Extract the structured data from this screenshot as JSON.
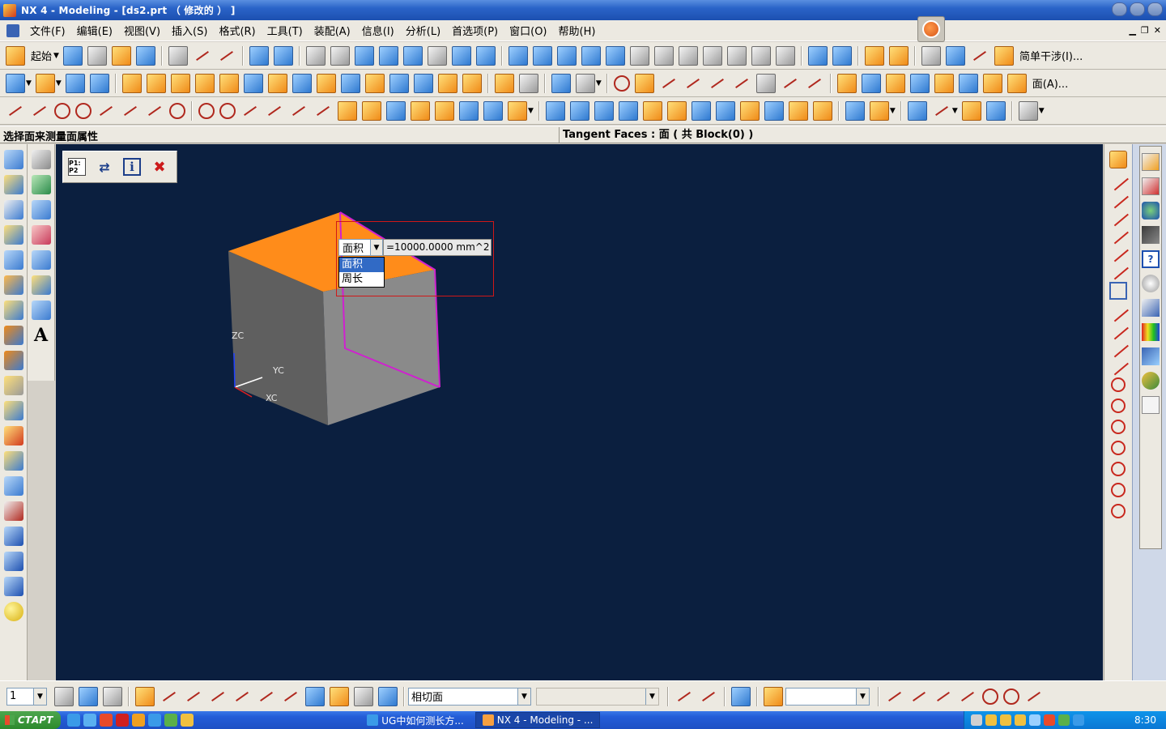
{
  "window": {
    "title": "NX 4 - Modeling - [ds2.prt （ 修改的 ） ]"
  },
  "menubar": {
    "items": [
      "文件(F)",
      "编辑(E)",
      "视图(V)",
      "插入(S)",
      "格式(R)",
      "工具(T)",
      "装配(A)",
      "信息(I)",
      "分析(L)",
      "首选项(P)",
      "窗口(O)",
      "帮助(H)"
    ]
  },
  "toolbar1": {
    "start_label": "起始",
    "right_label": "简单干涉(I)..."
  },
  "toolbar2": {
    "face_label": "面(A)..."
  },
  "status": {
    "prompt": "选择面来测量面属性",
    "selection": "Tangent Faces : 面 ( 共 Block(0) )"
  },
  "viewport": {
    "measure": {
      "selected": "面积",
      "value": "=10000.0000 mm^2",
      "options": [
        "面积",
        "周长"
      ]
    },
    "wcs": {
      "zc": "ZC",
      "yc": "YC",
      "xc": "XC"
    },
    "minibar": {
      "p1p2_icon": "P1: P2",
      "info_icon": "i",
      "close_icon": "✖"
    },
    "colors": {
      "background": "#0b1f3f",
      "selected_face": "#ff8c1a",
      "highlight_edge": "#d020d0",
      "cube_face": "#8a8a8a"
    }
  },
  "bottombar": {
    "layer_value": "1",
    "filter_value": "相切面",
    "snap_combo_value": "",
    "extra_combo_value": ""
  },
  "taskbar": {
    "start": "СТАРТ",
    "tasks": [
      "UG中如何测长方...",
      "NX 4 - Modeling - ..."
    ],
    "clock": "8:30"
  }
}
